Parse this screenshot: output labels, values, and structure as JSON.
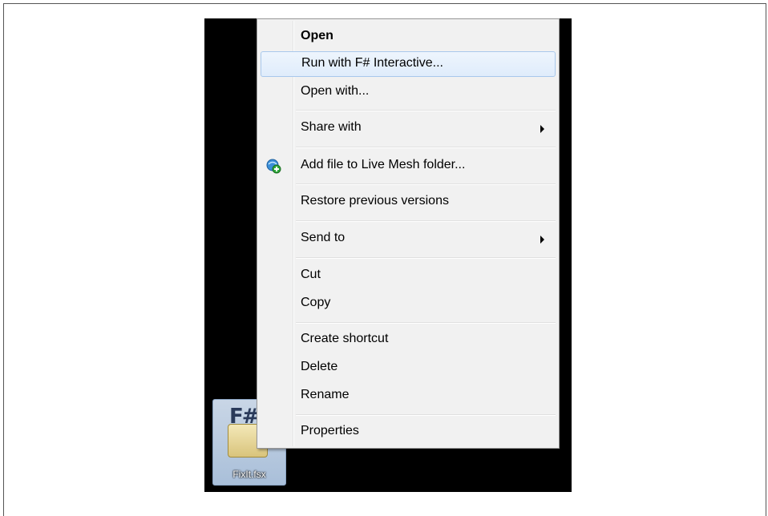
{
  "file": {
    "name": "FixIt.fsx",
    "icon": "fsharp-script-icon"
  },
  "menu": {
    "items": [
      {
        "label": "Open"
      },
      {
        "label": "Run with F# Interactive..."
      },
      {
        "label": "Open with..."
      },
      {
        "label": "Share with"
      },
      {
        "label": "Add file to Live Mesh folder..."
      },
      {
        "label": "Restore previous versions"
      },
      {
        "label": "Send to"
      },
      {
        "label": "Cut"
      },
      {
        "label": "Copy"
      },
      {
        "label": "Create shortcut"
      },
      {
        "label": "Delete"
      },
      {
        "label": "Rename"
      },
      {
        "label": "Properties"
      }
    ]
  }
}
